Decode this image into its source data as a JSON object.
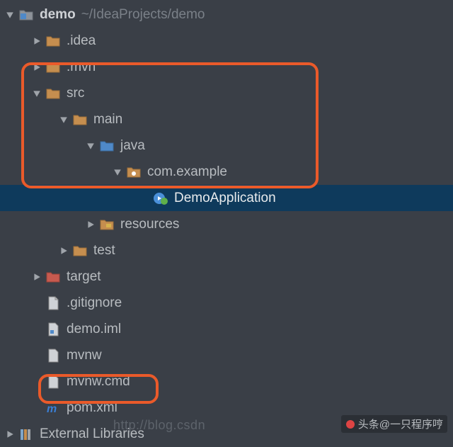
{
  "tree": {
    "root": {
      "name": "demo",
      "path": "~/IdeaProjects/demo"
    },
    "idea": ".idea",
    "mvn": ".mvn",
    "src": "src",
    "main": "main",
    "java": "java",
    "pkg": "com.example",
    "app": "DemoApplication",
    "resources": "resources",
    "test": "test",
    "target": "target",
    "gitignore": ".gitignore",
    "iml": "demo.iml",
    "mvnw": "mvnw",
    "mvnwcmd": "mvnw.cmd",
    "pom": "pom.xml",
    "extlib": "External Libraries"
  },
  "watermark": "http://blog.csdn",
  "credit": "头条@一只程序哼"
}
